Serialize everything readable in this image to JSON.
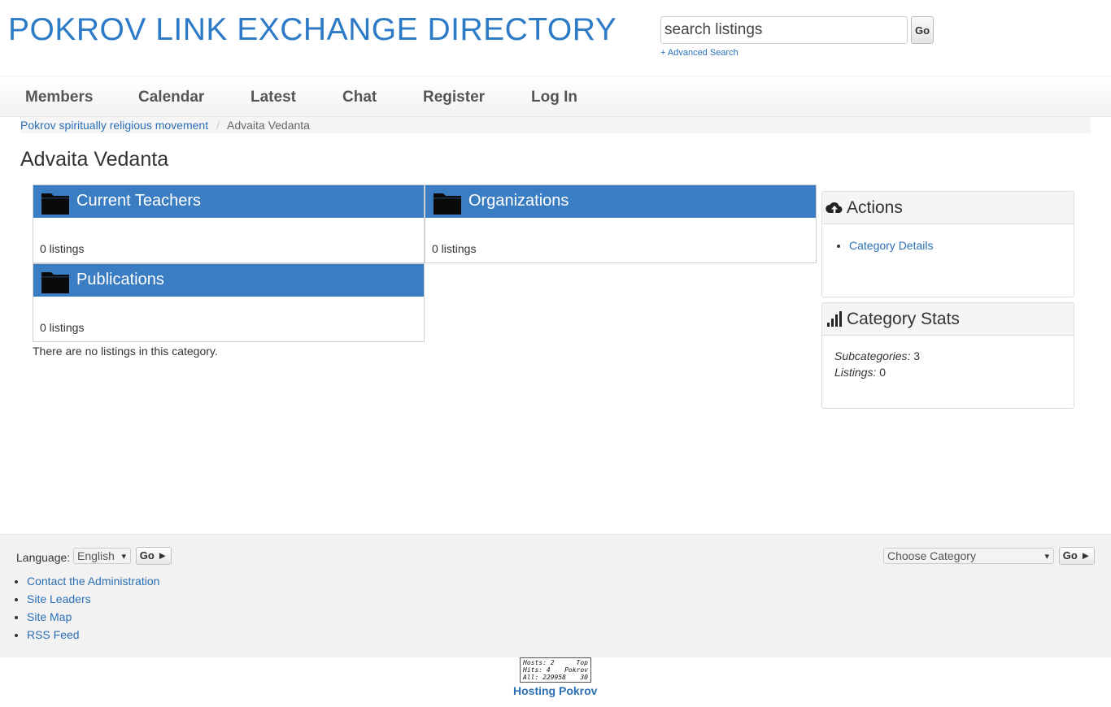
{
  "header": {
    "site_title": "POKROV LINK EXCHANGE DIRECTORY",
    "search_placeholder": "search listings",
    "search_button": "Go",
    "advanced_search": "+ Advanced Search"
  },
  "nav": {
    "items": [
      {
        "label": "Members"
      },
      {
        "label": "Calendar"
      },
      {
        "label": "Latest"
      },
      {
        "label": "Chat"
      },
      {
        "label": "Register"
      },
      {
        "label": "Log In"
      }
    ]
  },
  "breadcrumb": {
    "parent": "Pokrov spiritually religious movement",
    "separator": "/",
    "current": "Advaita Vedanta"
  },
  "page": {
    "title": "Advaita Vedanta",
    "no_listings": "There are no listings in this category."
  },
  "categories": [
    {
      "name": "Current Teachers",
      "count": "0 listings"
    },
    {
      "name": "Organizations",
      "count": "0 listings"
    },
    {
      "name": "Publications",
      "count": "0 listings"
    }
  ],
  "actions_panel": {
    "title": "Actions",
    "icon": "cloud-upload-icon",
    "items": [
      {
        "label": "Category Details"
      }
    ]
  },
  "stats_panel": {
    "title": "Category Stats",
    "icon": "bar-chart-icon",
    "subcategories_label": "Subcategories:",
    "subcategories_value": "3",
    "listings_label": "Listings:",
    "listings_value": "0"
  },
  "footer": {
    "language_label": "Language:",
    "language_selected": "English",
    "language_go": "Go ►",
    "category_selected": "Choose Category",
    "category_go": "Go ►",
    "links": [
      {
        "label": "Contact the Administration"
      },
      {
        "label": "Site Leaders"
      },
      {
        "label": "Site Map"
      },
      {
        "label": "RSS Feed"
      }
    ],
    "counter": {
      "hosts_label": "Hosts:",
      "hosts_value": "2",
      "top_label": "Top",
      "hits_label": "Hits:",
      "hits_value": "4",
      "top_name": "Pokrov",
      "all_label": "All:",
      "all_value": "229958",
      "rank": "30"
    },
    "hosting": "Hosting Pokrov"
  },
  "colors": {
    "brand": "#2d7bc6",
    "category_header": "#3b7dc2",
    "link": "#2a6fb5"
  }
}
